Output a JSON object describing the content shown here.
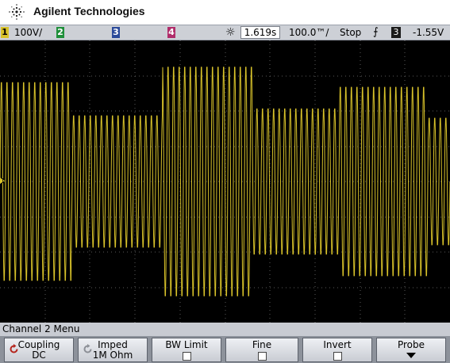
{
  "brand": {
    "name": "Agilent Technologies"
  },
  "status": {
    "ch1_num": "1",
    "ch1_scale": "100V/",
    "ch2_num": "2",
    "ch3_num": "3",
    "ch4_num": "4",
    "time_ref": "1.619s",
    "time_scale": "100.0™/",
    "run_state": "Stop",
    "trigger_slope": "⨍",
    "trigger_channel": "3",
    "trigger_level": "-1.55V"
  },
  "screen": {
    "ground_marker": "1",
    "trace_color": "#d8c22a",
    "grid_color": "#5a5a5a"
  },
  "menu": {
    "title": "Channel 2  Menu",
    "softkeys": [
      {
        "label": "Coupling",
        "value": "DC"
      },
      {
        "label": "Imped",
        "value": "1M Ohm"
      },
      {
        "label": "BW Limit",
        "value": ""
      },
      {
        "label": "Fine",
        "value": ""
      },
      {
        "label": "Invert",
        "value": ""
      },
      {
        "label": "Probe",
        "value": ""
      }
    ]
  }
}
